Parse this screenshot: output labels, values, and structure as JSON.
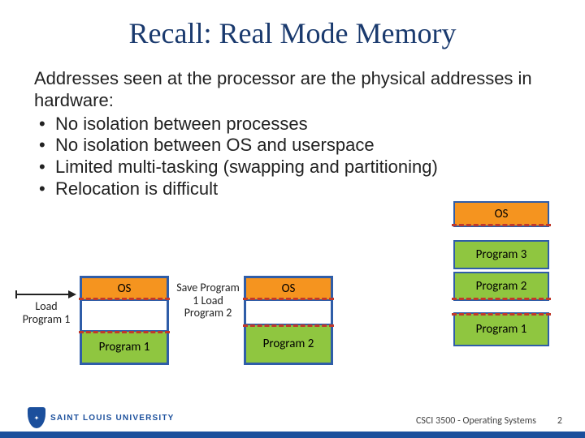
{
  "title": "Recall: Real Mode Memory",
  "intro": "Addresses seen at the processor are the physical addresses in hardware:",
  "bullets": [
    "No isolation between processes",
    "No isolation between OS and userspace",
    "Limited multi-tasking (swapping and partitioning)",
    "Relocation is difficult"
  ],
  "labels": {
    "os": "OS",
    "prog1": "Program 1",
    "prog2": "Program 2",
    "prog3": "Program 3",
    "load1": "Load Program 1",
    "save_load": "Save Program 1 Load Program 2"
  },
  "footer": {
    "course": "CSCI 3500 - Operating Systems",
    "page": "2",
    "university": "SAINT LOUIS UNIVERSITY"
  },
  "colors": {
    "title": "#1a3a6e",
    "os_fill": "#f5941f",
    "prog_fill": "#8fc640",
    "border": "#2f5da8",
    "dashed": "#c0392b",
    "footer_bar": "#1b4f9c"
  }
}
